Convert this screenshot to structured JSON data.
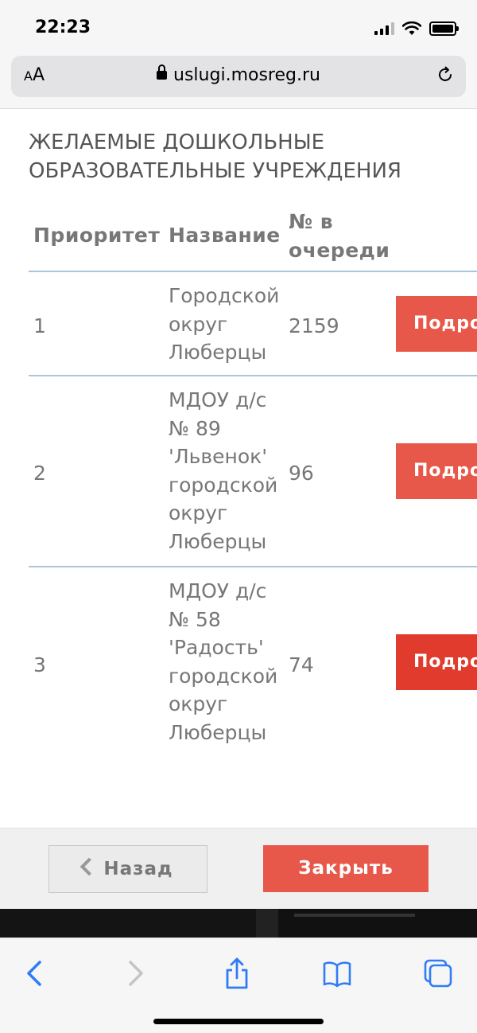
{
  "status_bar": {
    "time": "22:23"
  },
  "browser": {
    "aa_small": "A",
    "aa_large": "A",
    "url": "uslugi.mosreg.ru"
  },
  "section": {
    "title_line1": "ЖЕЛАЕМЫЕ ДОШКОЛЬНЫЕ",
    "title_line2": "ОБРАЗОВАТЕЛЬНЫЕ УЧРЕЖДЕНИЯ"
  },
  "table": {
    "headers": {
      "priority": "Приоритет",
      "name": "Название",
      "queue_line1": "№ в",
      "queue_line2": "очереди"
    },
    "rows": [
      {
        "priority": "1",
        "name_lines": [
          "Городской",
          "округ",
          "Люберцы"
        ],
        "queue": "2159",
        "button": "Подробнее"
      },
      {
        "priority": "2",
        "name_lines": [
          "МДОУ д/с",
          "№ 89",
          "'Львенок'",
          "городской",
          "округ",
          "Люберцы"
        ],
        "queue": "96",
        "button": "Подробнее"
      },
      {
        "priority": "3",
        "name_lines": [
          "МДОУ д/с",
          "№ 58",
          "'Радость'",
          "городской",
          "округ",
          "Люберцы"
        ],
        "queue": "74",
        "button": "Подробнее"
      }
    ]
  },
  "footer": {
    "back_label": "Назад",
    "close_label": "Закрыть"
  },
  "colors": {
    "accent": "#e8584a",
    "accent_active": "#e03b2c",
    "divider": "#a9c6de",
    "ios_blue": "#2f7cf6"
  }
}
